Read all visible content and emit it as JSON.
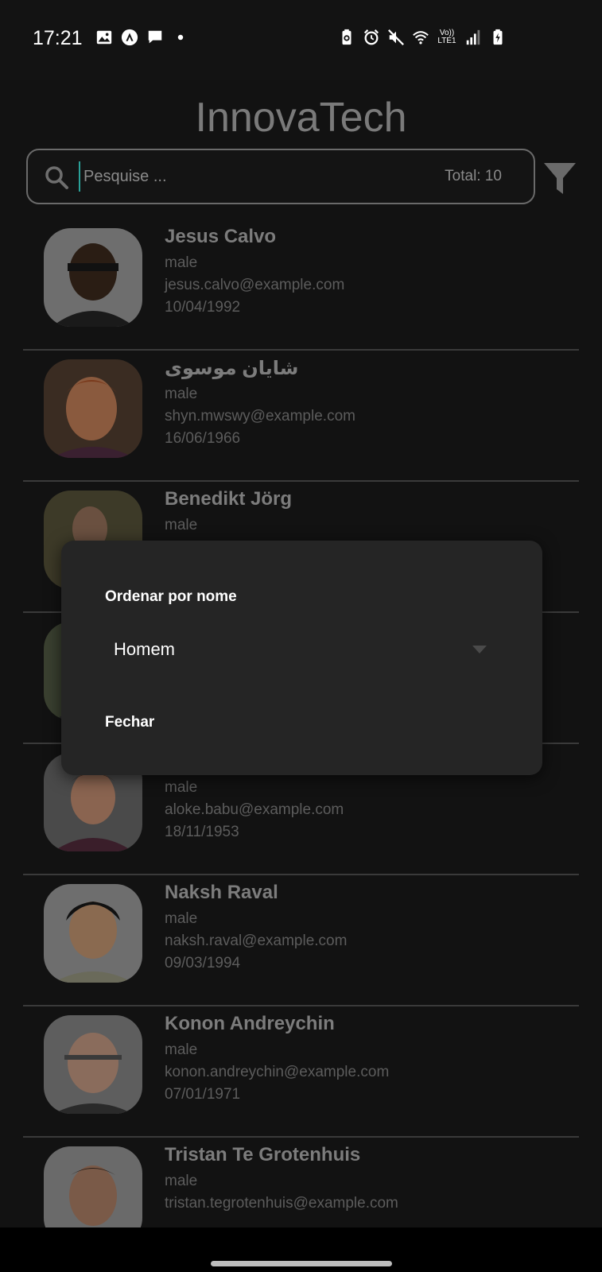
{
  "status_bar": {
    "time": "17:21",
    "network_label": "Vo)) LTE1",
    "left_icons": [
      "gallery-icon",
      "nav-a-icon",
      "message-icon",
      "dot-icon"
    ],
    "right_icons": [
      "battery-saver-icon",
      "alarm-icon",
      "mute-icon",
      "wifi-icon",
      "signal-icon",
      "battery-icon"
    ]
  },
  "header": {
    "title": "InnovaTech"
  },
  "search": {
    "placeholder": "Pesquise ...",
    "value": "",
    "total_label": "Total: 10"
  },
  "users": [
    {
      "name": "Jesus Calvo",
      "gender": "male",
      "email": "jesus.calvo@example.com",
      "dob": "10/04/1992"
    },
    {
      "name": "شايان موسوی",
      "gender": "male",
      "email": "shyn.mwswy@example.com",
      "dob": "16/06/1966"
    },
    {
      "name": "Benedikt Jörg",
      "gender": "male",
      "email": "",
      "dob": ""
    },
    {
      "name": "",
      "gender": "",
      "email": "",
      "dob": ""
    },
    {
      "name": "",
      "gender": "male",
      "email": "aloke.babu@example.com",
      "dob": "18/11/1953"
    },
    {
      "name": "Naksh Raval",
      "gender": "male",
      "email": "naksh.raval@example.com",
      "dob": "09/03/1994"
    },
    {
      "name": "Konon Andreychin",
      "gender": "male",
      "email": "konon.andreychin@example.com",
      "dob": "07/01/1971"
    },
    {
      "name": "Tristan Te Grotenhuis",
      "gender": "male",
      "email": "tristan.tegrotenhuis@example.com",
      "dob": ""
    }
  ],
  "dialog": {
    "title": "Ordenar por nome",
    "selected_option": "Homem",
    "close_label": "Fechar"
  },
  "colors": {
    "background": "#121212",
    "dialog": "#252525",
    "title": "#7a7a7a",
    "cursor": "#2aa198"
  }
}
